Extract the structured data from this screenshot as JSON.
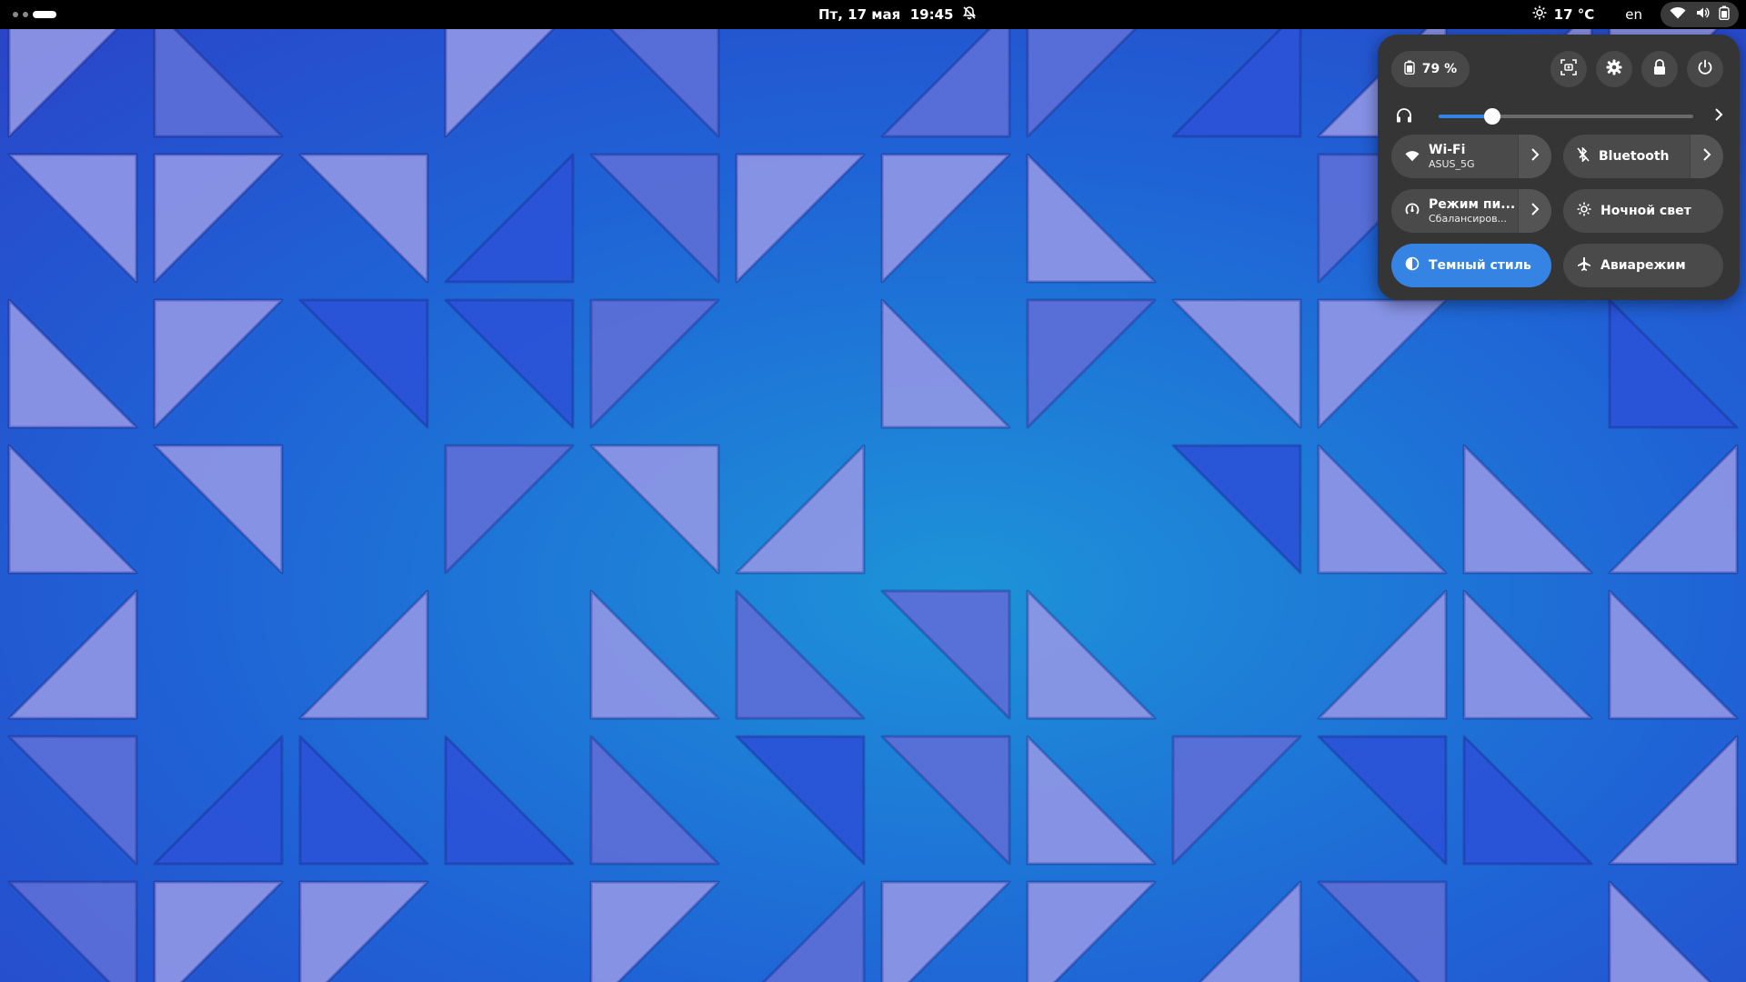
{
  "top_bar": {
    "datetime": "Пт, 17 мая  19:45",
    "weather_temp": "17 °C",
    "keyboard_layout": "en",
    "workspaces": {
      "count": 3,
      "active_index": 2
    }
  },
  "quick_settings": {
    "battery_label": "79 %",
    "volume": {
      "level_fraction": 0.21
    },
    "toggles": {
      "wifi": {
        "title": "Wi-Fi",
        "subtitle": "ASUS_5G",
        "active": true
      },
      "bluetooth": {
        "title": "Bluetooth",
        "active": false
      },
      "power_mode": {
        "title": "Режим пи...",
        "subtitle": "Сбалансиров...",
        "active": false
      },
      "night_light": {
        "title": "Ночной свет",
        "active": false
      },
      "dark_style": {
        "title": "Темный стиль",
        "active": true
      },
      "airplane": {
        "title": "Авиарежим",
        "active": false
      }
    }
  },
  "colors": {
    "accent": "#3584e4",
    "panel": "#353535",
    "button": "#484848",
    "wallpaper_base": "#1a4fd1"
  }
}
